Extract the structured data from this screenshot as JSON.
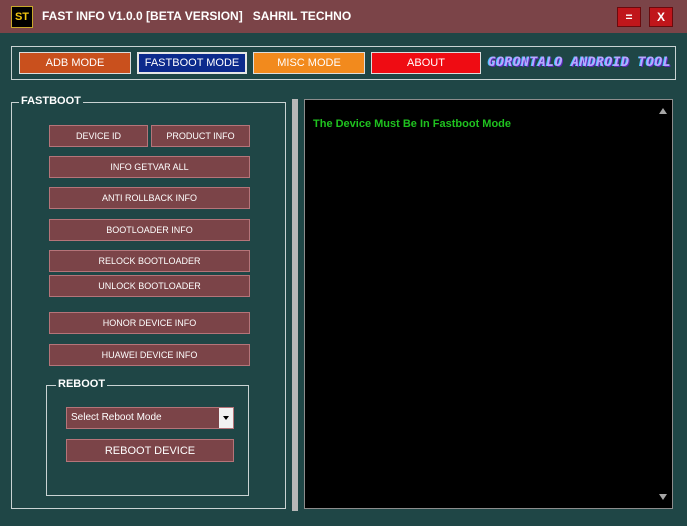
{
  "window": {
    "icon_text": "ST",
    "title": "FAST INFO V1.0.0 [BETA VERSION]   SAHRIL TECHNO",
    "minimize_label": "=",
    "close_label": "X"
  },
  "mode_tabs": [
    {
      "label": "ADB MODE",
      "color": "#c9501d"
    },
    {
      "label": "FASTBOOT  MODE",
      "color": "#0c2a8c",
      "selected": true
    },
    {
      "label": "MISC MODE",
      "color": "#f28a1d"
    },
    {
      "label": "ABOUT",
      "color": "#ef0c13"
    }
  ],
  "brand_text": "GORONTALO ANDROID TOOL",
  "fastboot": {
    "group_label": "FASTBOOT",
    "buttons": [
      "DEVICE ID",
      "PRODUCT INFO",
      "INFO GETVAR ALL",
      "ANTI ROLLBACK INFO",
      "BOOTLOADER INFO",
      "RELOCK BOOTLOADER",
      "UNLOCK BOOTLOADER",
      "HONOR DEVICE INFO",
      "HUAWEI DEVICE INFO"
    ]
  },
  "reboot": {
    "group_label": "REBOOT",
    "select_value": "Select Reboot Mode",
    "button_label": "REBOOT DEVICE"
  },
  "console": {
    "message": "The Device Must Be In Fastboot Mode",
    "text_color": "#1fc21f"
  }
}
